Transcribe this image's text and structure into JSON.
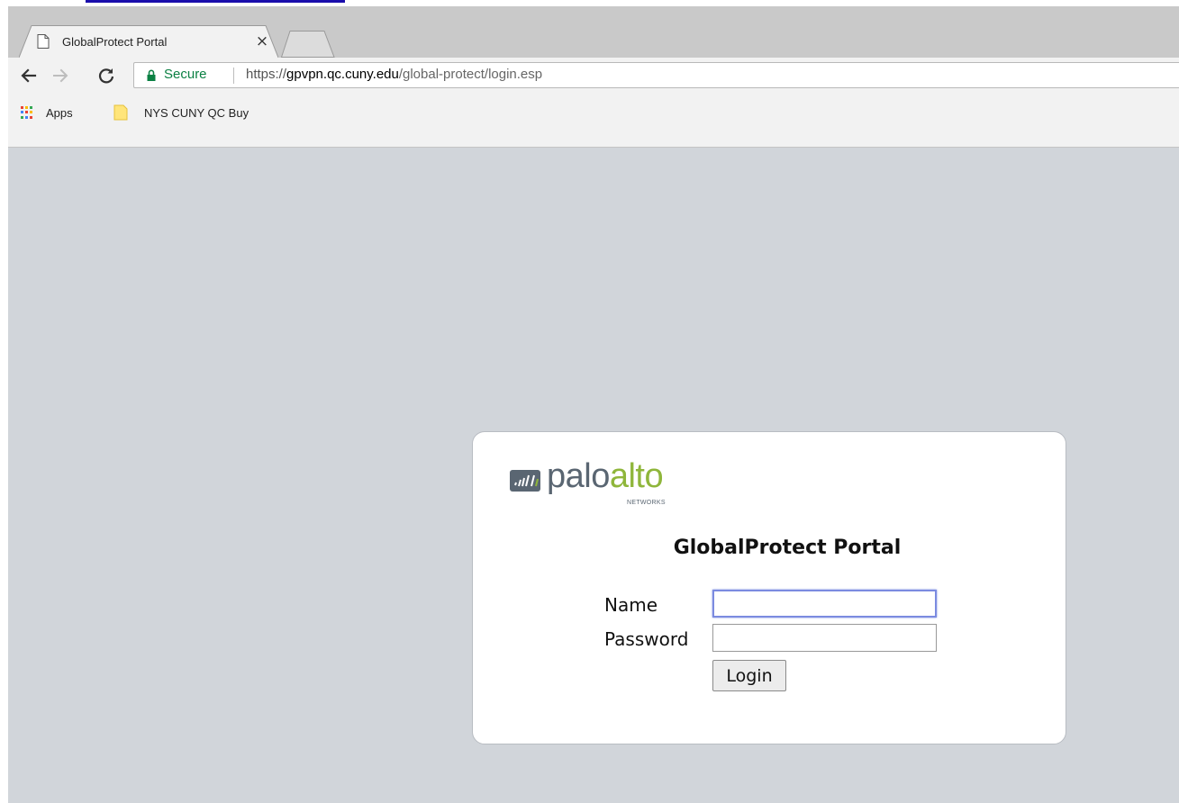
{
  "browser": {
    "tab": {
      "title": "GlobalProtect Portal",
      "close_glyph": "×",
      "icon": "page-icon"
    },
    "toolbar": {
      "back_icon": "back-arrow-icon",
      "forward_icon": "forward-arrow-icon",
      "reload_icon": "reload-icon",
      "security_label": "Secure",
      "url": {
        "scheme": "https://",
        "host": "gpvpn.qc.cuny.edu",
        "path": "/global-protect/login.esp"
      }
    },
    "bookmarks": [
      {
        "label": "Apps",
        "icon": "apps-grid-icon"
      },
      {
        "label": "NYS CUNY QC Buy",
        "icon": "folder-icon"
      }
    ]
  },
  "page": {
    "logo": {
      "word1": "palo",
      "word2": "alto",
      "sub": "NETWORKS"
    },
    "title": "GlobalProtect Portal",
    "form": {
      "name_label": "Name",
      "name_value": "",
      "password_label": "Password",
      "password_value": "",
      "login_label": "Login"
    }
  },
  "colors": {
    "secure_green": "#0b8043",
    "page_background": "#d1d5da",
    "logo_gray": "#5a6672",
    "logo_green": "#8fb63b",
    "focus_border": "#7b8be0"
  }
}
